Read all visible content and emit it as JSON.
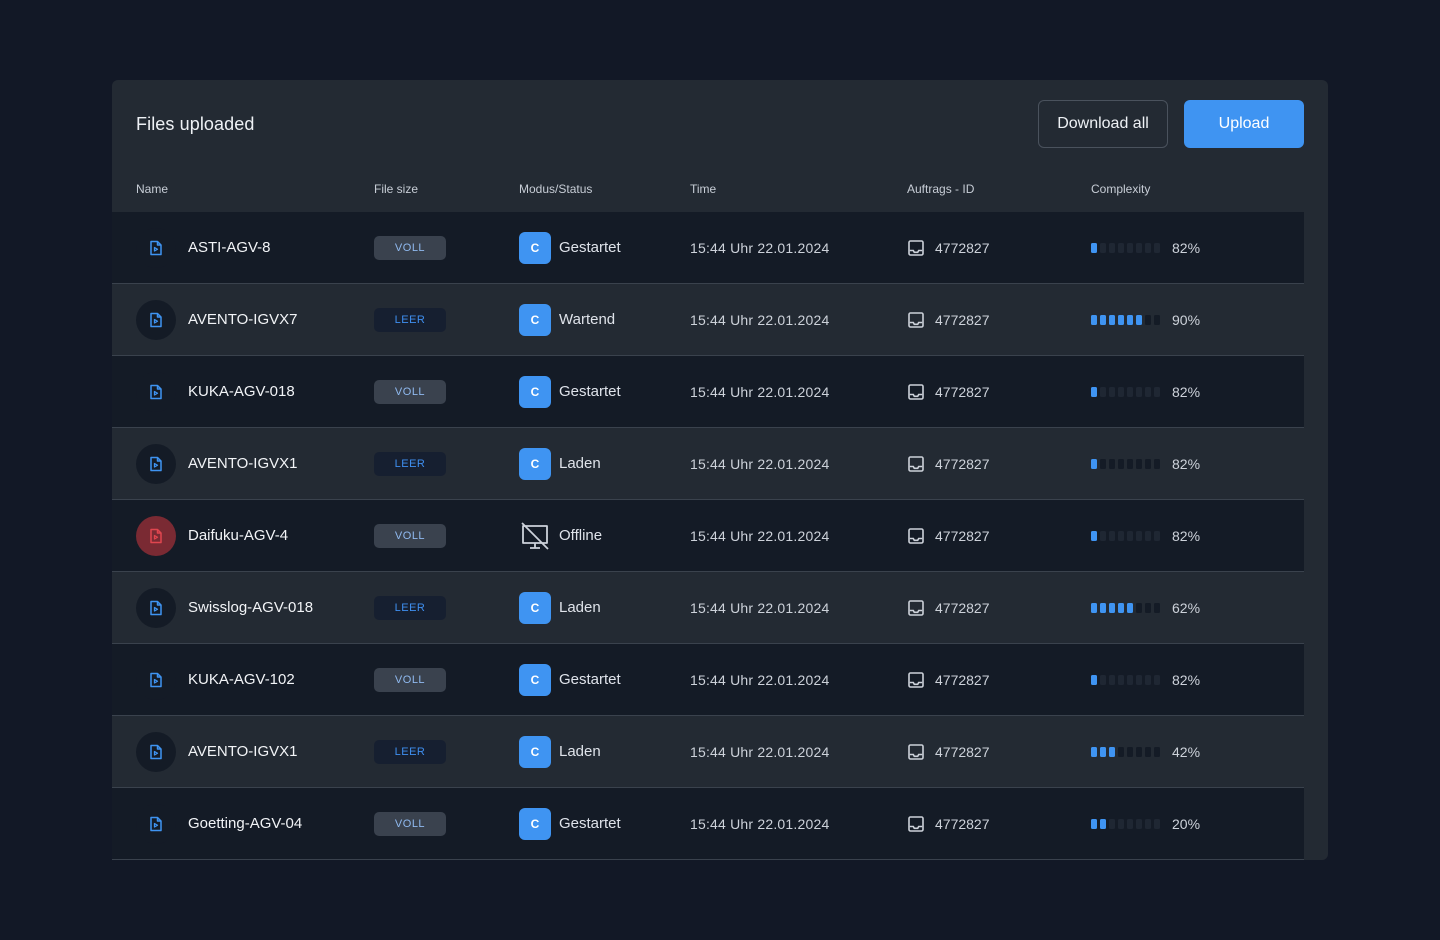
{
  "header": {
    "title": "Files uploaded",
    "download_all": "Download all",
    "upload": "Upload"
  },
  "columns": {
    "name": "Name",
    "file_size": "File size",
    "status": "Modus/Status",
    "time": "Time",
    "auftrag": "Auftrags - ID",
    "complexity": "Complexity"
  },
  "colors": {
    "accent": "#3f94f2",
    "bar_active": "#3f94f2",
    "bar_inactive_dark": "#1f2733",
    "bar_inactive_light": "#141b26",
    "error": "#e0464f"
  },
  "rows": [
    {
      "name": "ASTI-AGV-8",
      "size": "VOLL",
      "status_letter": "C",
      "status": "Gestartet",
      "time": "15:44 Uhr 22.01.2024",
      "auftrag": "4772827",
      "complexity_label": "82%",
      "complexity_level": 0.125,
      "icon": "file-icon"
    },
    {
      "name": "AVENTO-IGVX7",
      "size": "LEER",
      "status_letter": "C",
      "status": "Wartend",
      "time": "15:44 Uhr 22.01.2024",
      "auftrag": "4772827",
      "complexity_label": "90%",
      "complexity_level": 0.75,
      "icon": "file-icon"
    },
    {
      "name": "KUKA-AGV-018",
      "size": "VOLL",
      "status_letter": "C",
      "status": "Gestartet",
      "time": "15:44 Uhr 22.01.2024",
      "auftrag": "4772827",
      "complexity_label": "82%",
      "complexity_level": 0.125,
      "icon": "file-icon"
    },
    {
      "name": "AVENTO-IGVX1",
      "size": "LEER",
      "status_letter": "C",
      "status": "Laden",
      "time": "15:44 Uhr 22.01.2024",
      "auftrag": "4772827",
      "complexity_label": "82%",
      "complexity_level": 0.125,
      "icon": "file-icon"
    },
    {
      "name": "Daifuku-AGV-4",
      "size": "VOLL",
      "status_letter": "",
      "status": "Offline",
      "time": "15:44 Uhr 22.01.2024",
      "auftrag": "4772827",
      "complexity_label": "82%",
      "complexity_level": 0.125,
      "icon": "file-error-icon"
    },
    {
      "name": "Swisslog-AGV-018",
      "size": "LEER",
      "status_letter": "C",
      "status": "Laden",
      "time": "15:44 Uhr 22.01.2024",
      "auftrag": "4772827",
      "complexity_label": "62%",
      "complexity_level": 0.625,
      "icon": "file-icon"
    },
    {
      "name": "KUKA-AGV-102",
      "size": "VOLL",
      "status_letter": "C",
      "status": "Gestartet",
      "time": "15:44 Uhr 22.01.2024",
      "auftrag": "4772827",
      "complexity_label": "82%",
      "complexity_level": 0.125,
      "icon": "file-icon"
    },
    {
      "name": "AVENTO-IGVX1",
      "size": "LEER",
      "status_letter": "C",
      "status": "Laden",
      "time": "15:44 Uhr 22.01.2024",
      "auftrag": "4772827",
      "complexity_label": "42%",
      "complexity_level": 0.375,
      "icon": "file-icon"
    },
    {
      "name": "Goetting-AGV-04",
      "size": "VOLL",
      "status_letter": "C",
      "status": "Gestartet",
      "time": "15:44 Uhr 22.01.2024",
      "auftrag": "4772827",
      "complexity_label": "20%",
      "complexity_level": 0.25,
      "icon": "file-icon"
    }
  ]
}
